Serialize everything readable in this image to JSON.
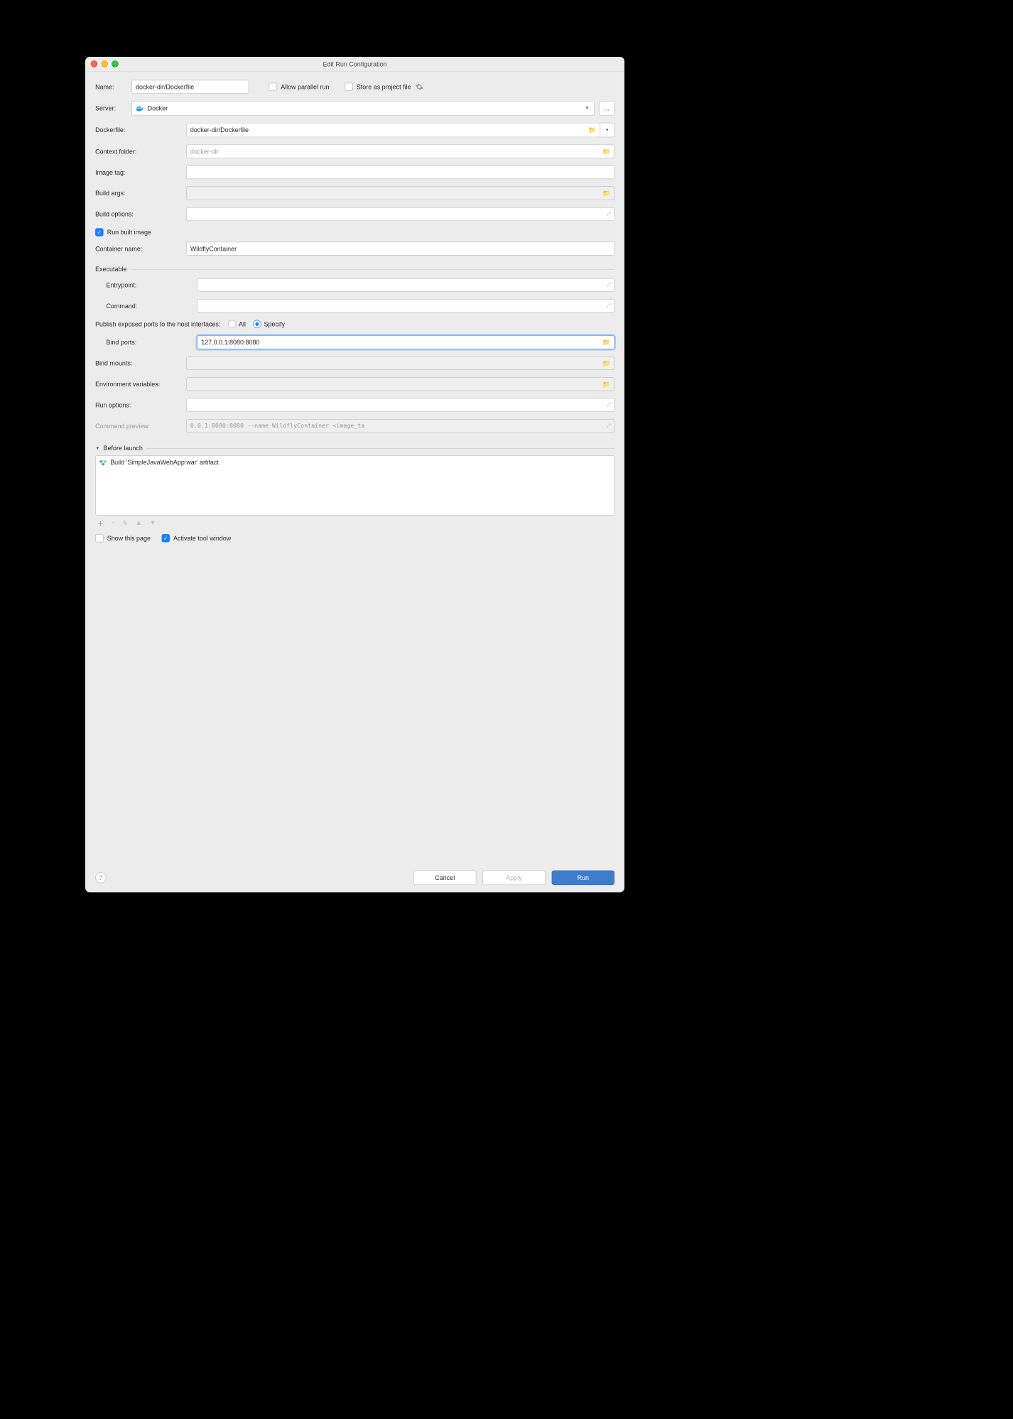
{
  "dialog_title": "Edit Run Configuration",
  "name": {
    "label": "Name:",
    "value": "docker-dir/Dockerfile"
  },
  "allow_parallel": {
    "label": "Allow parallel run",
    "checked": false
  },
  "store_as_project_file": {
    "label": "Store as project file",
    "checked": false
  },
  "server": {
    "label": "Server:",
    "selected": "Docker",
    "more_button": "..."
  },
  "dockerfile": {
    "label": "Dockerfile:",
    "value": "docker-dir/Dockerfile"
  },
  "context_folder": {
    "label": "Context folder:",
    "placeholder": "docker-dir",
    "value": ""
  },
  "image_tag": {
    "label": "Image tag:",
    "value": ""
  },
  "build_args": {
    "label": "Build args:",
    "value": ""
  },
  "build_options": {
    "label": "Build options:",
    "value": ""
  },
  "run_built_image": {
    "label": "Run built image",
    "checked": true
  },
  "container_name": {
    "label": "Container name:",
    "value": "WildflyContainer"
  },
  "executable_section": "Executable",
  "entrypoint": {
    "label": "Entrypoint:",
    "value": ""
  },
  "command": {
    "label": "Command:",
    "value": ""
  },
  "publish": {
    "label": "Publish exposed ports to the host interfaces:",
    "options": {
      "all": "All",
      "specify": "Specify"
    },
    "selected": "specify"
  },
  "bind_ports": {
    "label": "Bind ports:",
    "value": "127.0.0.1:8080:8080"
  },
  "bind_mounts": {
    "label": "Bind mounts:",
    "value": ""
  },
  "env_vars": {
    "label": "Environment variables:",
    "value": ""
  },
  "run_options": {
    "label": "Run options:",
    "value": ""
  },
  "command_preview": {
    "label": "Command preview:",
    "value": "0.0.1:8080:8080 --name WildflyContainer <image_ta"
  },
  "before_launch": {
    "title": "Before launch",
    "items": [
      "Build 'SimpleJavaWebApp:war' artifact"
    ]
  },
  "show_this_page": {
    "label": "Show this page",
    "checked": false
  },
  "activate_tool_window": {
    "label": "Activate tool window",
    "checked": true
  },
  "buttons": {
    "cancel": "Cancel",
    "apply": "Apply",
    "run": "Run"
  }
}
